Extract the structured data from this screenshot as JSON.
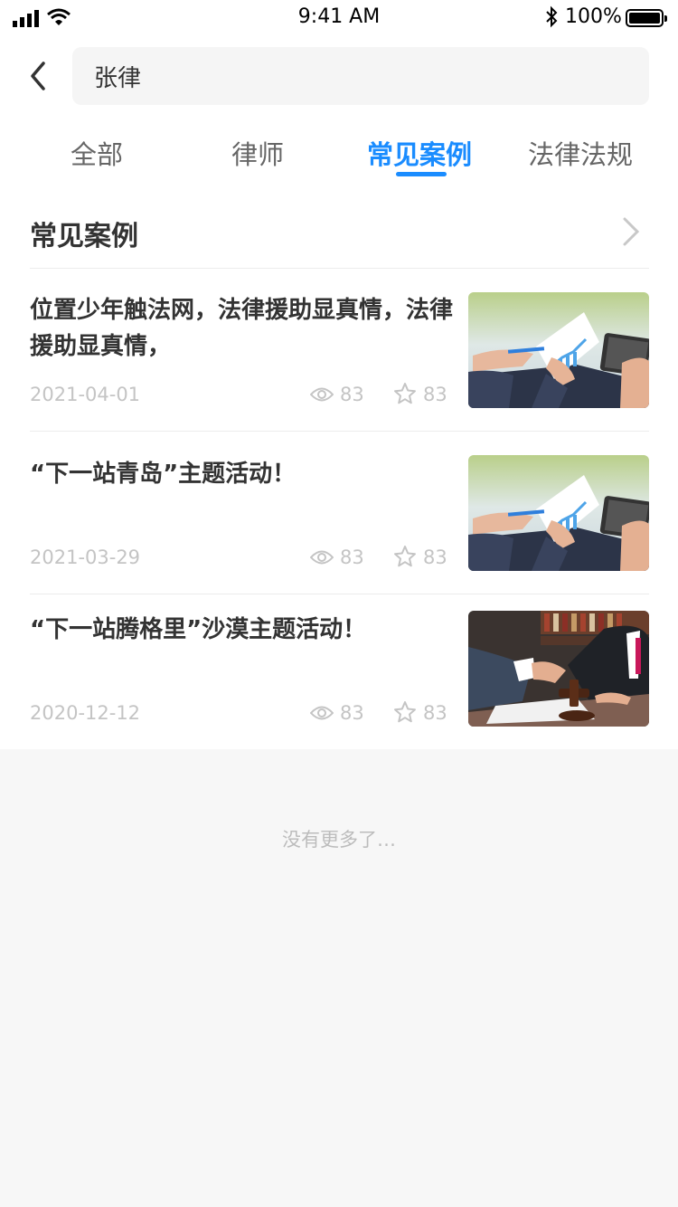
{
  "status_bar": {
    "time": "9:41 AM",
    "battery": "100%",
    "bluetooth_symbol": "✱"
  },
  "search": {
    "value": "张律"
  },
  "tabs": [
    {
      "label": "全部"
    },
    {
      "label": "律师"
    },
    {
      "label": "常见案例"
    },
    {
      "label": "法律法规"
    }
  ],
  "active_tab_index": 2,
  "section": {
    "title": "常见案例"
  },
  "items": [
    {
      "title": "位置少年触法网，法律援助显真情，法律援助显真情，",
      "date": "2021-04-01",
      "views": "83",
      "favorites": "83",
      "image": "documents-chart-photo"
    },
    {
      "title": "“下一站青岛”主题活动！",
      "date": "2021-03-29",
      "views": "83",
      "favorites": "83",
      "image": "documents-chart-photo"
    },
    {
      "title": "“下一站腾格里”沙漠主题活动！",
      "date": "2020-12-12",
      "views": "83",
      "favorites": "83",
      "image": "handshake-gavel-photo"
    }
  ],
  "footer": {
    "no_more": "没有更多了…"
  },
  "colors": {
    "accent": "#1a8cff",
    "muted": "#c4c4c4",
    "background": "#f7f7f7"
  }
}
